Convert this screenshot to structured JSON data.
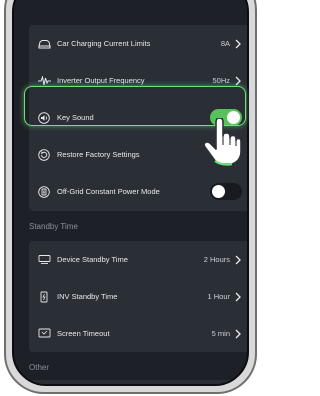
{
  "settings": {
    "rows": [
      {
        "label": "Car Charging Current Limits",
        "value": "8A",
        "icon": "car-charging-icon"
      },
      {
        "label": "Inverter Output Frequency",
        "value": "50Hz",
        "icon": "wave-icon"
      },
      {
        "label": "Key Sound",
        "value": "",
        "icon": "speaker-icon",
        "toggle": true
      },
      {
        "label": "Restore Factory Settings",
        "value": "",
        "icon": "restore-icon"
      },
      {
        "label": "Off-Grid Constant Power Mode",
        "value": "",
        "icon": "power-mode-icon",
        "toggle": false
      }
    ]
  },
  "standby": {
    "title": "Standby Time",
    "rows": [
      {
        "label": "Device Standby Time",
        "value": "2 Hours",
        "icon": "device-standby-icon"
      },
      {
        "label": "INV Standby Time",
        "value": "1 Hour",
        "icon": "inverter-icon"
      },
      {
        "label": "Screen Timeout",
        "value": "5 min",
        "icon": "screen-icon"
      }
    ]
  },
  "other": {
    "title": "Other"
  },
  "colors": {
    "accent": "#58c25a",
    "highlight": "#6fe07c",
    "toggle_off": "#171a1f",
    "card": "#2a2f36",
    "background": "#1d2127"
  }
}
